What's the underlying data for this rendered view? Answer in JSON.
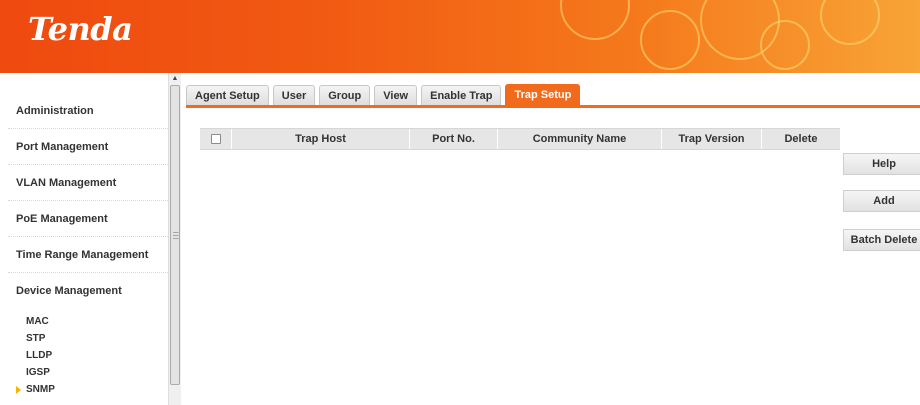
{
  "header": {
    "logo": "Tenda"
  },
  "sidebar": {
    "items": [
      {
        "label": "Administration"
      },
      {
        "label": "Port Management"
      },
      {
        "label": "VLAN Management"
      },
      {
        "label": "PoE Management"
      },
      {
        "label": "Time Range Management"
      },
      {
        "label": "Device Management"
      }
    ],
    "subitems": [
      {
        "label": "MAC"
      },
      {
        "label": "STP"
      },
      {
        "label": "LLDP"
      },
      {
        "label": "IGSP"
      },
      {
        "label": "SNMP"
      }
    ]
  },
  "tabs": [
    {
      "label": "Agent Setup"
    },
    {
      "label": "User"
    },
    {
      "label": "Group"
    },
    {
      "label": "View"
    },
    {
      "label": "Enable Trap"
    },
    {
      "label": "Trap Setup"
    }
  ],
  "table": {
    "columns": [
      "Trap Host",
      "Port No.",
      "Community Name",
      "Trap Version",
      "Delete"
    ]
  },
  "buttons": {
    "help": "Help",
    "add": "Add",
    "batch_delete": "Batch Delete"
  },
  "colors": {
    "accent": "#f26a1b",
    "header_start": "#ef4a10",
    "header_end": "#f8a436"
  }
}
